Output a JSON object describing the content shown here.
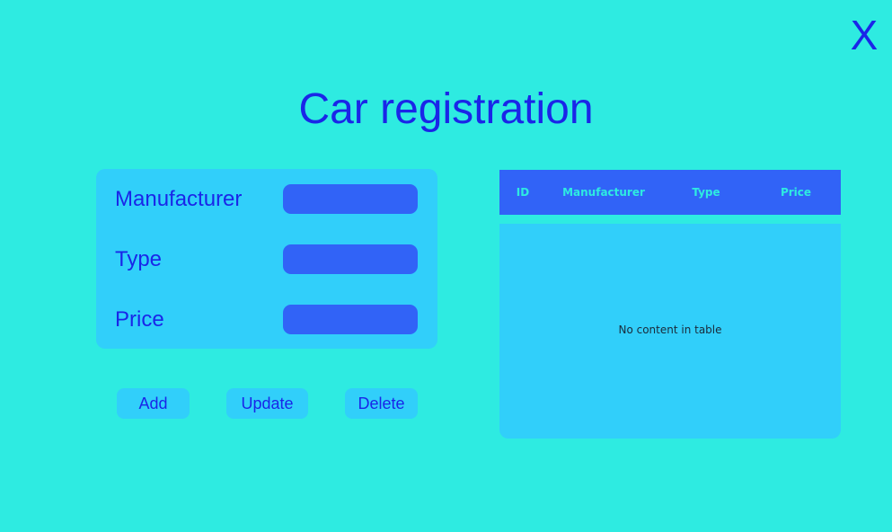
{
  "window": {
    "close_label": "X"
  },
  "page": {
    "title": "Car registration"
  },
  "form": {
    "fields": [
      {
        "label": "Manufacturer",
        "value": ""
      },
      {
        "label": "Type",
        "value": ""
      },
      {
        "label": "Price",
        "value": ""
      }
    ]
  },
  "actions": {
    "add_label": "Add",
    "update_label": "Update",
    "delete_label": "Delete"
  },
  "table": {
    "columns": [
      "ID",
      "Manufacturer",
      "Type",
      "Price"
    ],
    "rows": [],
    "placeholder": "No content in table"
  },
  "colors": {
    "background": "#2EEBE1",
    "panel": "#31CFFA",
    "accent": "#3163F7",
    "text": "#1A26E8"
  },
  "icons": {
    "close": "close-icon"
  }
}
